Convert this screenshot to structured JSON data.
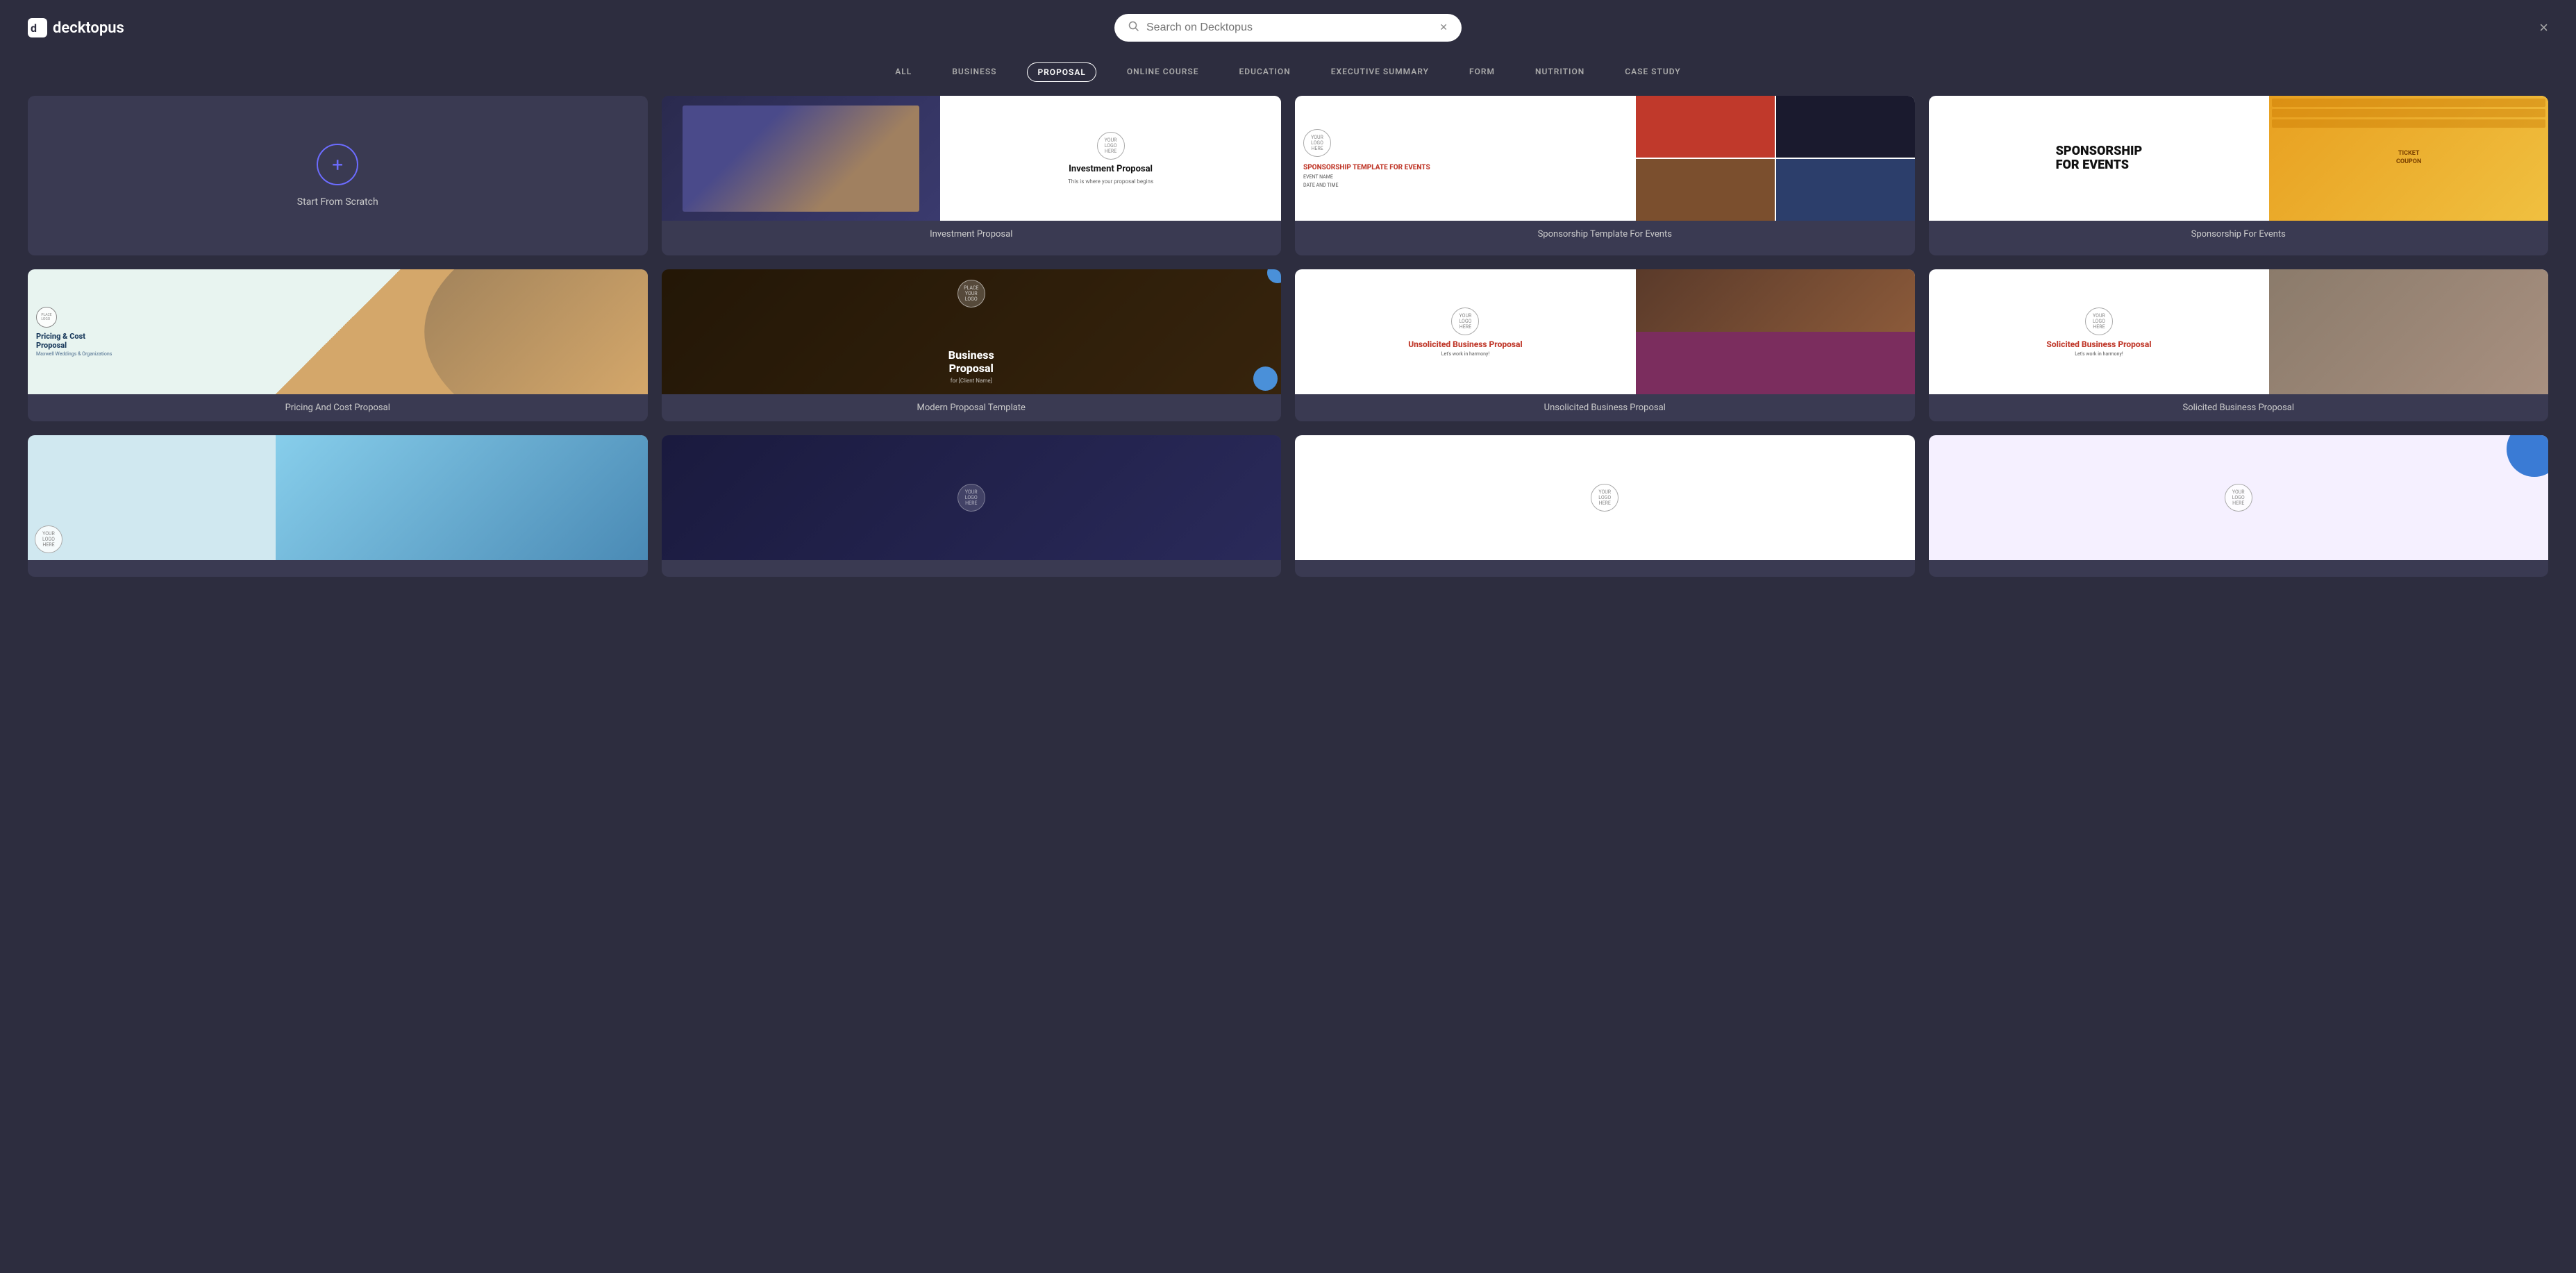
{
  "app": {
    "name": "decktopus",
    "logo_text": "decktopus"
  },
  "header": {
    "search_placeholder": "Search on Decktopus",
    "search_value": "",
    "close_label": "×"
  },
  "nav": {
    "tabs": [
      {
        "id": "all",
        "label": "ALL",
        "active": false
      },
      {
        "id": "business",
        "label": "BUSINESS",
        "active": false
      },
      {
        "id": "proposal",
        "label": "PROPOSAL",
        "active": true
      },
      {
        "id": "online-course",
        "label": "ONLINE COURSE",
        "active": false
      },
      {
        "id": "education",
        "label": "EDUCATION",
        "active": false
      },
      {
        "id": "executive-summary",
        "label": "EXECUTIVE SUMMARY",
        "active": false
      },
      {
        "id": "form",
        "label": "FORM",
        "active": false
      },
      {
        "id": "nutrition",
        "label": "NUTRITION",
        "active": false
      },
      {
        "id": "case-study",
        "label": "CASE STUDY",
        "active": false
      }
    ]
  },
  "grid": {
    "scratch_card": {
      "label": "Start From Scratch",
      "plus_icon": "+"
    },
    "templates": [
      {
        "id": "investment-proposal",
        "label": "Investment Proposal",
        "type": "investment"
      },
      {
        "id": "sponsorship-template-for-events",
        "label": "Sponsorship Template For Events",
        "type": "sponsorship-events"
      },
      {
        "id": "sponsorship-for-events",
        "label": "Sponsorship For Events",
        "type": "sponsorship-fe"
      },
      {
        "id": "pricing-cost-proposal",
        "label": "Pricing And Cost Proposal",
        "type": "pricing"
      },
      {
        "id": "modern-proposal-template",
        "label": "Modern Proposal Template",
        "type": "business-proposal"
      },
      {
        "id": "unsolicited-business-proposal",
        "label": "Unsolicited Business Proposal",
        "type": "unsolicited"
      },
      {
        "id": "solicited-business-proposal",
        "label": "Solicited Business Proposal",
        "type": "solicited"
      },
      {
        "id": "bottom-1",
        "label": "",
        "type": "bottom1"
      },
      {
        "id": "bottom-2",
        "label": "",
        "type": "bottom2"
      },
      {
        "id": "bottom-3",
        "label": "",
        "type": "bottom3"
      },
      {
        "id": "bottom-4",
        "label": "",
        "type": "bottom4"
      }
    ]
  }
}
